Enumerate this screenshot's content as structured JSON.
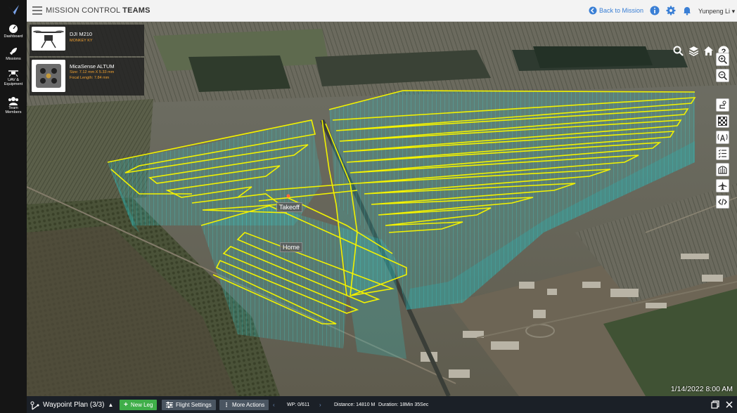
{
  "sidebar": {
    "items": [
      {
        "label": "Dashboard",
        "icon": "dashboard-gauge-icon"
      },
      {
        "label": "Missions",
        "icon": "rocket-icon"
      },
      {
        "label": "UAV &\nEquipment",
        "label_line1": "UAV &",
        "label_line2": "Equipment",
        "icon": "drone-icon"
      },
      {
        "label": "Team Members",
        "label_line1": "Team",
        "label_line2": "Members",
        "icon": "team-icon"
      }
    ]
  },
  "header": {
    "title_prefix": "MISSION CONTROL",
    "title_bold": "TEAMS",
    "back_label": "Back to Mission",
    "user_name": "Yunpeng Li"
  },
  "equipment": [
    {
      "name": "DJI M210",
      "spec1": "MONKEY KY",
      "icon": "drone-thumbnail"
    },
    {
      "name": "MicaSense ALTUM",
      "spec1": "Size: 7.12 mm X 5.33 mm",
      "spec2": "Focal Length: 7.84 mm",
      "icon": "camera-thumbnail"
    }
  ],
  "map": {
    "labels": {
      "takeoff": "Takeoff",
      "home": "Home"
    },
    "timestamp": "1/14/2022 8:00 AM",
    "accent": "#f2f200",
    "volume_color": "#2fc7c7"
  },
  "bottom": {
    "plan_title": "Waypoint Plan (3/3)",
    "new_leg": "New Leg",
    "flight_settings": "Flight Settings",
    "more_actions": "More Actions",
    "waypoint_counter": "WP: 0/611",
    "distance": "Distance: 14810 M",
    "duration": "Duration: 18Min 35Sec"
  }
}
